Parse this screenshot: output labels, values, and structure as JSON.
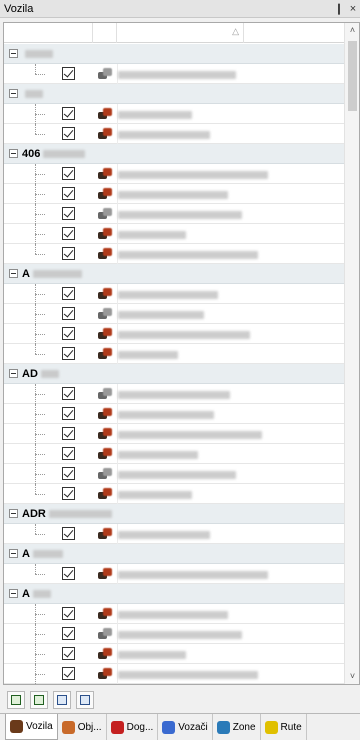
{
  "window": {
    "title": "Vozila",
    "pin_glyph": "❙",
    "close_glyph": "×"
  },
  "grid": {
    "sort_glyph": "△",
    "groups": [
      {
        "label": "",
        "rows": 1
      },
      {
        "label": "",
        "rows": 2
      },
      {
        "label": "406",
        "rows": 5
      },
      {
        "label": "A",
        "rows": 4
      },
      {
        "label": "AD",
        "rows": 6
      },
      {
        "label": "ADR",
        "rows": 1
      },
      {
        "label": "A",
        "rows": 1
      },
      {
        "label": "A",
        "rows": 6
      }
    ]
  },
  "scrollbar": {
    "up_glyph": "˄",
    "down_glyph": "˅"
  },
  "tabs": [
    {
      "label": "Vozila",
      "icon": "car-icon",
      "color": "#6a3a1a"
    },
    {
      "label": "Obj...",
      "icon": "objects-icon",
      "color": "#c86a2a"
    },
    {
      "label": "Dog...",
      "icon": "events-icon",
      "color": "#c42020"
    },
    {
      "label": "Vozači",
      "icon": "drivers-icon",
      "color": "#3a6ad0"
    },
    {
      "label": "Zone",
      "icon": "zone-icon",
      "color": "#2a7ab8"
    },
    {
      "label": "Rute",
      "icon": "route-icon",
      "color": "#e0c000"
    }
  ]
}
